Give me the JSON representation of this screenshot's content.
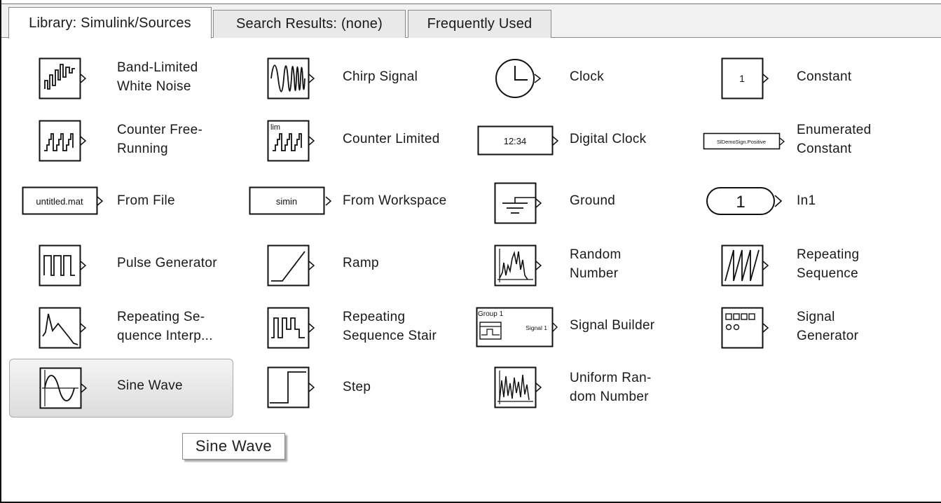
{
  "tabs": [
    {
      "label": "Library: Simulink/Sources",
      "active": true
    },
    {
      "label": "Search Results: (none)",
      "active": false
    },
    {
      "label": "Frequently Used",
      "active": false
    }
  ],
  "blocks": [
    {
      "name": "Band-Limited\nWhite Noise",
      "icon": "band-limited-white-noise-icon"
    },
    {
      "name": "Chirp Signal",
      "icon": "chirp-signal-icon"
    },
    {
      "name": "Clock",
      "icon": "clock-icon"
    },
    {
      "name": "Constant",
      "icon": "constant-icon",
      "icon_text": "1"
    },
    {
      "name": "Counter Free-\nRunning",
      "icon": "counter-free-running-icon"
    },
    {
      "name": "Counter Limited",
      "icon": "counter-limited-icon",
      "icon_text": "lim"
    },
    {
      "name": "Digital Clock",
      "icon": "digital-clock-icon",
      "icon_text": "12:34"
    },
    {
      "name": "Enumerated\nConstant",
      "icon": "enumerated-constant-icon",
      "icon_text": "SlDemoSign.Positive"
    },
    {
      "name": "From File",
      "icon": "from-file-icon",
      "icon_text": "untitled.mat"
    },
    {
      "name": "From Workspace",
      "icon": "from-workspace-icon",
      "icon_text": "simin"
    },
    {
      "name": "Ground",
      "icon": "ground-icon"
    },
    {
      "name": "In1",
      "icon": "in1-port-icon",
      "icon_text": "1"
    },
    {
      "name": "Pulse Generator",
      "icon": "pulse-generator-icon"
    },
    {
      "name": "Ramp",
      "icon": "ramp-icon"
    },
    {
      "name": "Random\nNumber",
      "icon": "random-number-icon"
    },
    {
      "name": "Repeating\nSequence",
      "icon": "repeating-sequence-icon"
    },
    {
      "name": "Repeating Se-\nquence Interp...",
      "icon": "repeating-sequence-interp-icon"
    },
    {
      "name": "Repeating\nSequence Stair",
      "icon": "repeating-sequence-stair-icon"
    },
    {
      "name": "Signal Builder",
      "icon": "signal-builder-icon",
      "icon_text": "Group 1",
      "icon_text2": "Signal 1"
    },
    {
      "name": "Signal\nGenerator",
      "icon": "signal-generator-icon"
    },
    {
      "name": "Sine Wave",
      "icon": "sine-wave-icon",
      "selected": true
    },
    {
      "name": "Step",
      "icon": "step-icon"
    },
    {
      "name": "Uniform Ran-\ndom Number",
      "icon": "uniform-random-number-icon"
    }
  ],
  "tooltip": {
    "text": "Sine Wave"
  }
}
